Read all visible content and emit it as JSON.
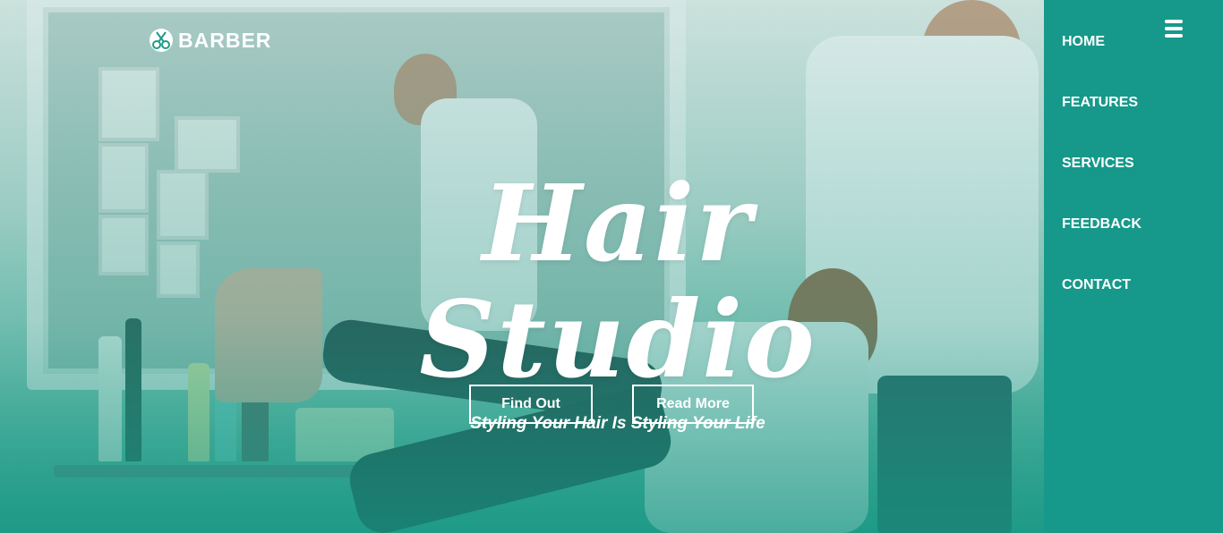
{
  "logo": {
    "text": "BARBER",
    "icon": "scissors-logo-icon"
  },
  "hero": {
    "title": "Hair Studio",
    "subtitle": "Styling Your Hair Is Styling Your Life",
    "buttons": {
      "find_out": "Find Out",
      "read_more": "Read More"
    }
  },
  "nav": {
    "menu_icon": "hamburger-menu-icon",
    "items": [
      {
        "label": "HOME"
      },
      {
        "label": "FEATURES"
      },
      {
        "label": "SERVICES"
      },
      {
        "label": "FEEDBACK"
      },
      {
        "label": "CONTACT"
      }
    ]
  },
  "colors": {
    "sidebar": "#16998a",
    "accent": "#1f9c8a",
    "text": "#ffffff"
  }
}
